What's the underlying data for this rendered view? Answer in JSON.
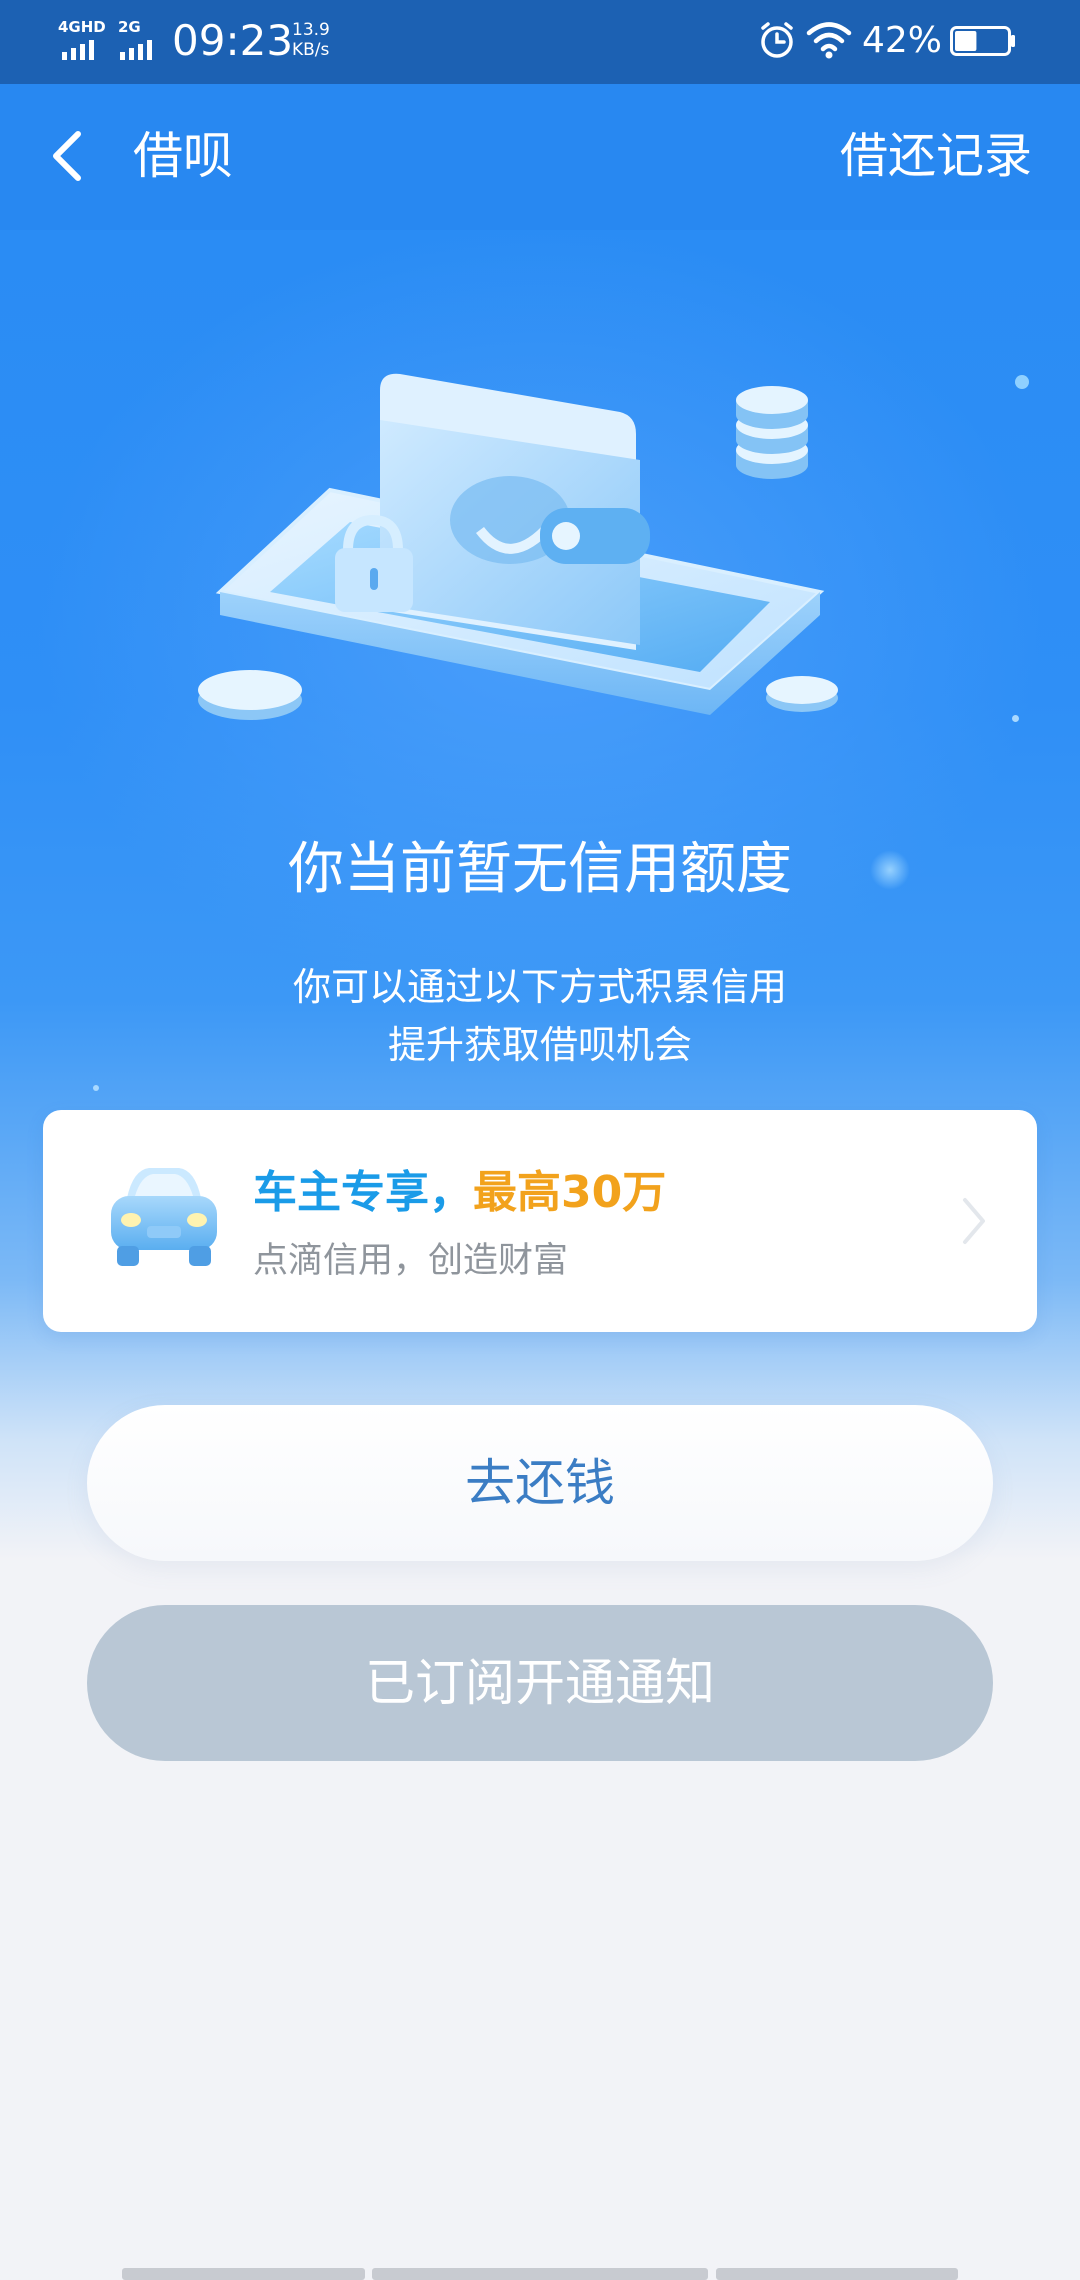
{
  "status_bar": {
    "network_1": "4GHD",
    "network_2": "2G",
    "time": "09:23",
    "speed_value": "13.9",
    "speed_unit": "KB/s",
    "battery": "42%",
    "battery_level": 0.42
  },
  "nav": {
    "back_icon": "chevron-left-icon",
    "title": "借呗",
    "right_action": "借还记录"
  },
  "hero": {
    "illustration": "wallet-tablet-illustration",
    "headline": "你当前暂无信用额度",
    "sub_line1": "你可以通过以下方式积累信用",
    "sub_line2": "提升获取借呗机会"
  },
  "promo": {
    "icon": "car-icon",
    "title_part1": "车主专享，",
    "title_part2": "最高30万",
    "subtitle": "点滴信用，创造财富",
    "chevron": "chevron-right-icon",
    "colors": {
      "title_blue": "#1a9be8",
      "title_orange": "#f2a21c"
    }
  },
  "buttons": {
    "repay": "去还钱",
    "subscribed": "已订阅开通通知"
  },
  "colors": {
    "brand_blue": "#2888f1",
    "status_bar": "#1c61b3",
    "disabled_button": "#b9c7d5"
  }
}
